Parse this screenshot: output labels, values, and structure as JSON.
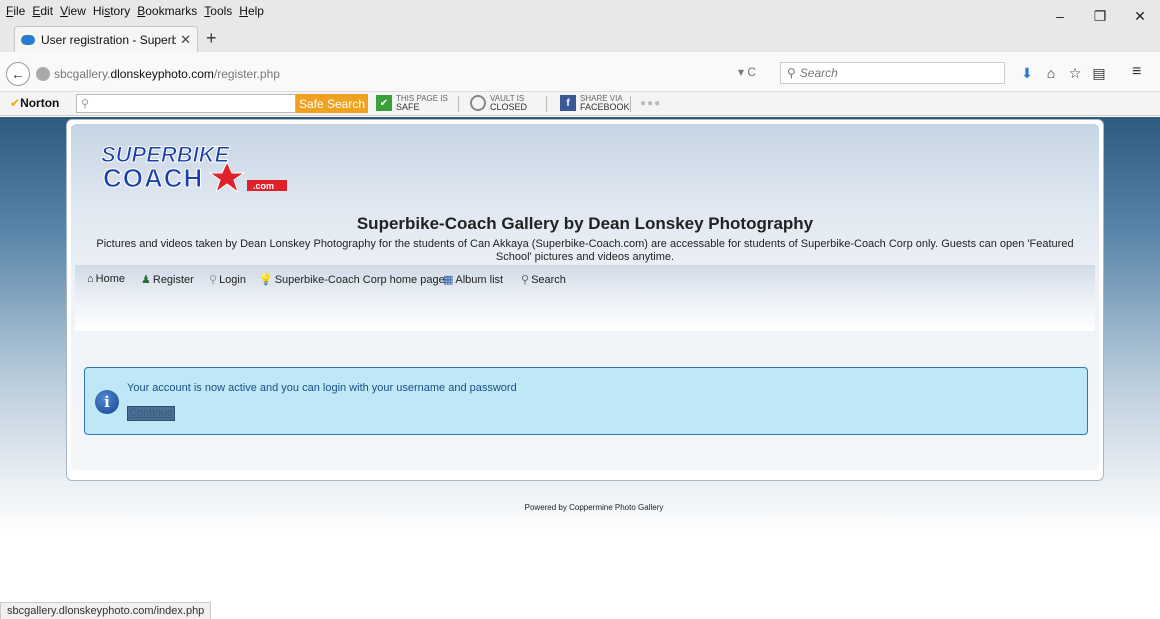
{
  "menu": {
    "items": [
      {
        "accel": "F",
        "rest": "ile"
      },
      {
        "accel": "E",
        "rest": "dit"
      },
      {
        "accel": "V",
        "rest": "iew"
      },
      {
        "pre": "Hi",
        "accel": "s",
        "rest": "tory"
      },
      {
        "accel": "B",
        "rest": "ookmarks"
      },
      {
        "accel": "T",
        "rest": "ools"
      },
      {
        "accel": "H",
        "rest": "elp"
      }
    ]
  },
  "window_controls": {
    "minimize": "–",
    "restore": "❐",
    "close": "✕"
  },
  "tab": {
    "title": "User registration - Superbi...",
    "close": "✕",
    "new": "+"
  },
  "nav": {
    "url_prefix": "sbcgallery.",
    "url_domain": "dlonskeyphoto.com",
    "url_path": "/register.php",
    "url_controls": "▾ C",
    "search_placeholder": "Search"
  },
  "norton": {
    "logo": "Norton",
    "safe_search": "Safe Search",
    "page_status_line1": "THIS PAGE IS",
    "page_status_line2": "SAFE",
    "vault_line1": "VAULT IS",
    "vault_line2": "CLOSED",
    "share_line1": "SHARE VIA",
    "share_line2": "FACEBOOK"
  },
  "page": {
    "title": "Superbike-Coach Gallery by Dean Lonskey Photography",
    "description": "Pictures and videos taken by Dean Lonskey Photography for the students of Can Akkaya (Superbike-Coach.com) are accessable for students of Superbike-Coach Corp only. Guests can open 'Featured School' pictures and videos anytime.",
    "logo_line1": "SUPERBIKE",
    "logo_line2": "COACH",
    "logo_com": ".com",
    "nav": {
      "home": "Home",
      "register": "Register",
      "login": "Login",
      "corp": "Superbike-Coach Corp home page",
      "albums": "Album list",
      "search": "Search"
    },
    "info_message": "Your account is now active and you can login with your username and password",
    "continue": "Continue",
    "powered": "Powered by Coppermine Photo Gallery"
  },
  "status_bar": "sbcgallery.dlonskeyphoto.com/index.php"
}
